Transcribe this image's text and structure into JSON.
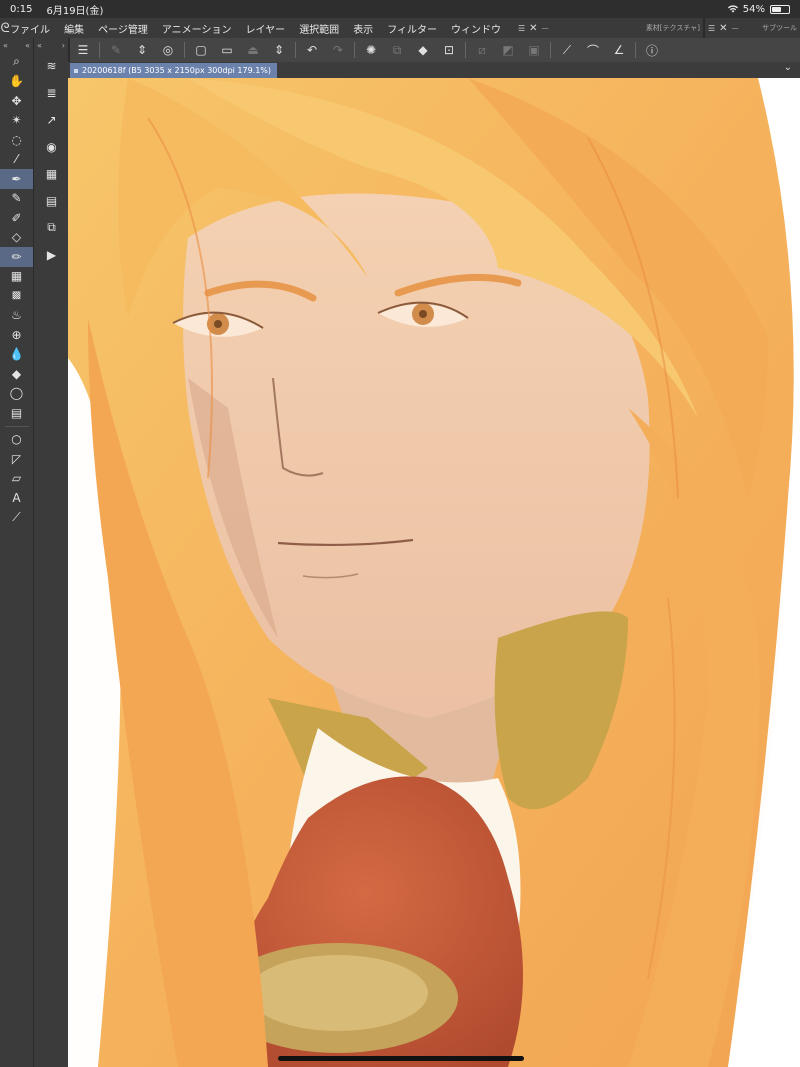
{
  "status": {
    "time": "0:15",
    "date": "6月19日(金)",
    "battery": "54%",
    "battery_level": 0.54
  },
  "menu": {
    "items": [
      "ファイル",
      "編集",
      "ページ管理",
      "アニメーション",
      "レイヤー",
      "選択範囲",
      "表示",
      "フィルター",
      "ウィンドウ"
    ]
  },
  "panels": {
    "material": "素材[テクスチャ]",
    "subtool": "サブツール"
  },
  "canvas": {
    "tab_label": "20200618f (B5 3035 x 2150px 300dpi 179.1%)"
  },
  "colors": {
    "ui_dark": "#3b3b3b",
    "active_tool": "#5a6a86",
    "tab_blue": "#6b82ad",
    "hair": "#f5b45c",
    "skin": "#f3cfb0",
    "ascot": "#c85b3a",
    "gold": "#c9a44a"
  }
}
